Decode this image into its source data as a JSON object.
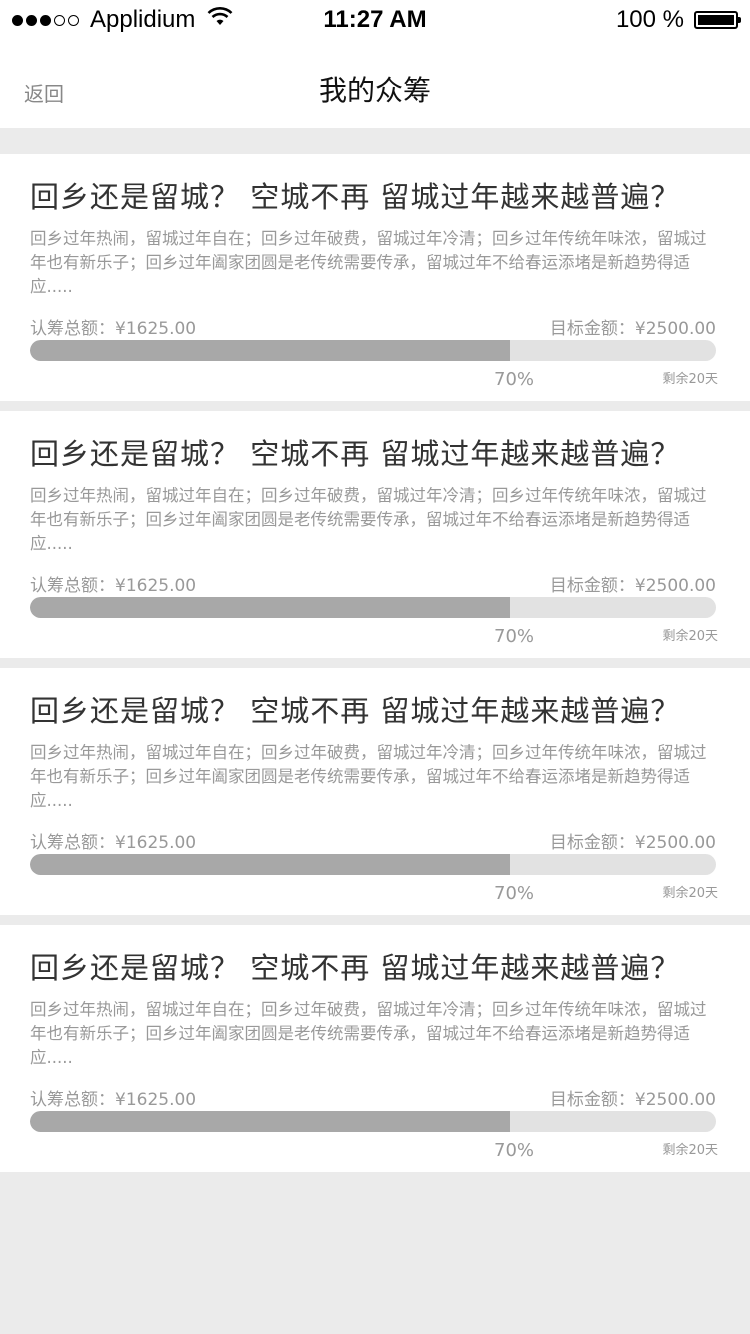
{
  "status_bar": {
    "carrier": "Applidium",
    "time": "11:27 AM",
    "battery_text": "100 %",
    "signal_bars_filled": 3,
    "signal_bars_total": 5
  },
  "nav": {
    "back_label": "返回",
    "title": "我的众筹"
  },
  "projects": [
    {
      "title": "回乡还是留城？ 空城不再 留城过年越来越普遍？",
      "description": "回乡过年热闹，留城过年自在；回乡过年破费，留城过年冷清；回乡过年传统年味浓，留城过年也有新乐子；回乡过年阖家团圆是老传统需要传承，留城过年不给春运添堵是新趋势得适应.....",
      "raised_label": "认筹总额：¥1625.00",
      "target_label": "目标金额：¥2500.00",
      "progress": 0.7,
      "percent_label": "70%",
      "remaining_label": "剩余20天"
    },
    {
      "title": "回乡还是留城？ 空城不再 留城过年越来越普遍？",
      "description": "回乡过年热闹，留城过年自在；回乡过年破费，留城过年冷清；回乡过年传统年味浓，留城过年也有新乐子；回乡过年阖家团圆是老传统需要传承，留城过年不给春运添堵是新趋势得适应.....",
      "raised_label": "认筹总额：¥1625.00",
      "target_label": "目标金额：¥2500.00",
      "progress": 0.7,
      "percent_label": "70%",
      "remaining_label": "剩余20天"
    },
    {
      "title": "回乡还是留城？ 空城不再 留城过年越来越普遍？",
      "description": "回乡过年热闹，留城过年自在；回乡过年破费，留城过年冷清；回乡过年传统年味浓，留城过年也有新乐子；回乡过年阖家团圆是老传统需要传承，留城过年不给春运添堵是新趋势得适应.....",
      "raised_label": "认筹总额：¥1625.00",
      "target_label": "目标金额：¥2500.00",
      "progress": 0.7,
      "percent_label": "70%",
      "remaining_label": "剩余20天"
    },
    {
      "title": "回乡还是留城？ 空城不再 留城过年越来越普遍？",
      "description": "回乡过年热闹，留城过年自在；回乡过年破费，留城过年冷清；回乡过年传统年味浓，留城过年也有新乐子；回乡过年阖家团圆是老传统需要传承，留城过年不给春运添堵是新趋势得适应.....",
      "raised_label": "认筹总额：¥1625.00",
      "target_label": "目标金额：¥2500.00",
      "progress": 0.7,
      "percent_label": "70%",
      "remaining_label": "剩余20天"
    }
  ],
  "colors": {
    "background": "#ebebeb",
    "card": "#ffffff",
    "progress_fill": "#a8a8a8",
    "progress_track": "#e2e2e2",
    "muted_text": "#999999"
  }
}
